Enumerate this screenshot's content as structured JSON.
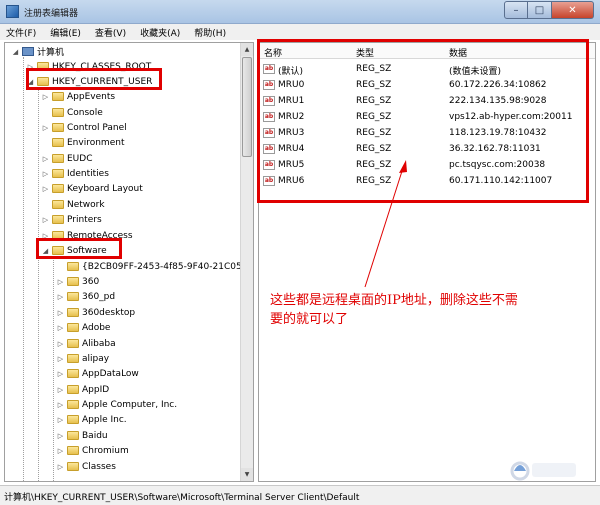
{
  "window": {
    "title": "注册表编辑器",
    "minimize": "–",
    "maximize": "□",
    "close": "✕"
  },
  "menu": [
    "文件(F)",
    "编辑(E)",
    "查看(V)",
    "收藏夹(A)",
    "帮助(H)"
  ],
  "tree": [
    {
      "label": "计算机",
      "arrow": "◢",
      "icon": "computer"
    },
    {
      "label": "HKEY_CLASSES_ROOT",
      "arrow": "▷",
      "icon": "folder"
    },
    {
      "label": "HKEY_CURRENT_USER",
      "arrow": "◢",
      "icon": "folder"
    },
    {
      "label": "AppEvents",
      "arrow": "▷",
      "icon": "folder"
    },
    {
      "label": "Console",
      "arrow": "",
      "icon": "folder"
    },
    {
      "label": "Control Panel",
      "arrow": "▷",
      "icon": "folder"
    },
    {
      "label": "Environment",
      "arrow": "",
      "icon": "folder"
    },
    {
      "label": "EUDC",
      "arrow": "▷",
      "icon": "folder"
    },
    {
      "label": "Identities",
      "arrow": "▷",
      "icon": "folder"
    },
    {
      "label": "Keyboard Layout",
      "arrow": "▷",
      "icon": "folder"
    },
    {
      "label": "Network",
      "arrow": "",
      "icon": "folder"
    },
    {
      "label": "Printers",
      "arrow": "▷",
      "icon": "folder"
    },
    {
      "label": "RemoteAccess",
      "arrow": "▷",
      "icon": "folder"
    },
    {
      "label": "Software",
      "arrow": "◢",
      "icon": "folder"
    },
    {
      "label": "{B2CB09FF-2453-4f85-9F40-21C05E",
      "arrow": "",
      "icon": "folder"
    },
    {
      "label": "360",
      "arrow": "▷",
      "icon": "folder"
    },
    {
      "label": "360_pd",
      "arrow": "▷",
      "icon": "folder"
    },
    {
      "label": "360desktop",
      "arrow": "▷",
      "icon": "folder"
    },
    {
      "label": "Adobe",
      "arrow": "▷",
      "icon": "folder"
    },
    {
      "label": "Alibaba",
      "arrow": "▷",
      "icon": "folder"
    },
    {
      "label": "alipay",
      "arrow": "▷",
      "icon": "folder"
    },
    {
      "label": "AppDataLow",
      "arrow": "▷",
      "icon": "folder"
    },
    {
      "label": "AppID",
      "arrow": "▷",
      "icon": "folder"
    },
    {
      "label": "Apple Computer, Inc.",
      "arrow": "▷",
      "icon": "folder"
    },
    {
      "label": "Apple Inc.",
      "arrow": "▷",
      "icon": "folder"
    },
    {
      "label": "Baidu",
      "arrow": "▷",
      "icon": "folder"
    },
    {
      "label": "Chromium",
      "arrow": "▷",
      "icon": "folder"
    },
    {
      "label": "Classes",
      "arrow": "▷",
      "icon": "folder"
    }
  ],
  "values": {
    "columns": [
      "名称",
      "类型",
      "数据"
    ],
    "rows": [
      {
        "name": "(默认)",
        "type": "REG_SZ",
        "data": "(数值未设置)"
      },
      {
        "name": "MRU0",
        "type": "REG_SZ",
        "data": "60.172.226.34:10862"
      },
      {
        "name": "MRU1",
        "type": "REG_SZ",
        "data": "222.134.135.98:9028"
      },
      {
        "name": "MRU2",
        "type": "REG_SZ",
        "data": "vps12.ab-hyper.com:20011"
      },
      {
        "name": "MRU3",
        "type": "REG_SZ",
        "data": "118.123.19.78:10432"
      },
      {
        "name": "MRU4",
        "type": "REG_SZ",
        "data": "36.32.162.78:11031"
      },
      {
        "name": "MRU5",
        "type": "REG_SZ",
        "data": "pc.tsqysc.com:20038"
      },
      {
        "name": "MRU6",
        "type": "REG_SZ",
        "data": "60.171.110.142:11007"
      }
    ],
    "icon_text": "ab"
  },
  "annotation": {
    "line1": "这些都是远程桌面的IP地址，删除这些不需",
    "line2": "要的就可以了",
    "color": "#e00000"
  },
  "status": "计算机\\HKEY_CURRENT_USER\\Software\\Microsoft\\Terminal Server Client\\Default",
  "colors": {
    "highlight": "#e00000",
    "titlebar": "#b8cfea"
  }
}
